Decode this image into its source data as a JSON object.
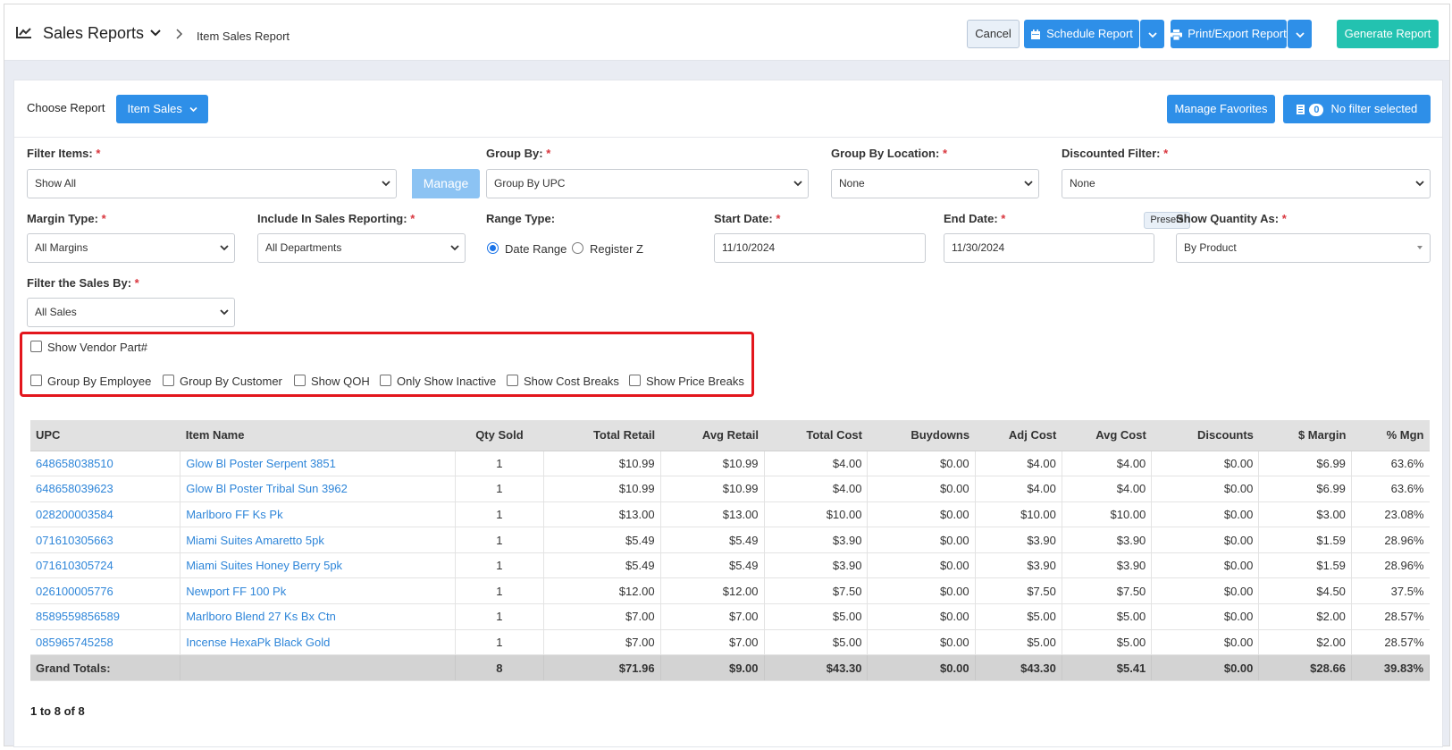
{
  "header": {
    "title": "Sales Reports",
    "breadcrumb": "Item Sales Report",
    "cancel": "Cancel",
    "schedule": "Schedule Report",
    "print": "Print/Export Report",
    "generate": "Generate Report"
  },
  "report_bar": {
    "choose_label": "Choose Report",
    "report_button": "Item Sales",
    "manage_favorites": "Manage Favorites",
    "filter_count": "0",
    "filter_text": "No filter selected"
  },
  "filters": {
    "filter_items": {
      "label": "Filter Items:",
      "value": "Show All",
      "manage": "Manage"
    },
    "group_by": {
      "label": "Group By:",
      "value": "Group By UPC"
    },
    "group_by_location": {
      "label": "Group By Location:",
      "value": "None"
    },
    "discounted": {
      "label": "Discounted Filter:",
      "value": "None"
    },
    "margin_type": {
      "label": "Margin Type:",
      "value": "All Margins"
    },
    "include_in_sales": {
      "label": "Include In Sales Reporting:",
      "value": "All Departments"
    },
    "range_type": {
      "label": "Range Type:",
      "option1": "Date Range",
      "option2": "Register Z"
    },
    "start_date": {
      "label": "Start Date:",
      "value": "11/10/2024"
    },
    "end_date": {
      "label": "End Date:",
      "value": "11/30/2024",
      "presets": "Presets"
    },
    "show_quantity": {
      "label": "Show Quantity As:",
      "value": "By Product"
    },
    "filter_sales_by": {
      "label": "Filter the Sales By:",
      "value": "All Sales"
    },
    "required_mark": "*"
  },
  "options": {
    "vendor_part": "Show Vendor Part#",
    "group_by_employee": "Group By Employee",
    "group_by_customer": "Group By Customer",
    "show_qoh": "Show QOH",
    "only_inactive": "Only Show Inactive",
    "show_cost_breaks": "Show Cost Breaks",
    "show_price_breaks": "Show Price Breaks"
  },
  "table": {
    "columns": [
      "UPC",
      "Item Name",
      "Qty Sold",
      "Total Retail",
      "Avg Retail",
      "Total Cost",
      "Buydowns",
      "Adj Cost",
      "Avg Cost",
      "Discounts",
      "$ Margin",
      "% Mgn"
    ],
    "rows": [
      [
        "648658038510",
        "Glow Bl Poster Serpent 3851",
        "1",
        "$10.99",
        "$10.99",
        "$4.00",
        "$0.00",
        "$4.00",
        "$4.00",
        "$0.00",
        "$6.99",
        "63.6%"
      ],
      [
        "648658039623",
        "Glow Bl Poster Tribal Sun 3962",
        "1",
        "$10.99",
        "$10.99",
        "$4.00",
        "$0.00",
        "$4.00",
        "$4.00",
        "$0.00",
        "$6.99",
        "63.6%"
      ],
      [
        "028200003584",
        "Marlboro FF Ks Pk",
        "1",
        "$13.00",
        "$13.00",
        "$10.00",
        "$0.00",
        "$10.00",
        "$10.00",
        "$0.00",
        "$3.00",
        "23.08%"
      ],
      [
        "071610305663",
        "Miami Suites Amaretto 5pk",
        "1",
        "$5.49",
        "$5.49",
        "$3.90",
        "$0.00",
        "$3.90",
        "$3.90",
        "$0.00",
        "$1.59",
        "28.96%"
      ],
      [
        "071610305724",
        "Miami Suites Honey Berry 5pk",
        "1",
        "$5.49",
        "$5.49",
        "$3.90",
        "$0.00",
        "$3.90",
        "$3.90",
        "$0.00",
        "$1.59",
        "28.96%"
      ],
      [
        "026100005776",
        "Newport FF 100 Pk",
        "1",
        "$12.00",
        "$12.00",
        "$7.50",
        "$0.00",
        "$7.50",
        "$7.50",
        "$0.00",
        "$4.50",
        "37.5%"
      ],
      [
        "8589559856589",
        "Marlboro Blend 27 Ks Bx Ctn",
        "1",
        "$7.00",
        "$7.00",
        "$5.00",
        "$0.00",
        "$5.00",
        "$5.00",
        "$0.00",
        "$2.00",
        "28.57%"
      ],
      [
        "085965745258",
        "Incense HexaPk Black Gold",
        "1",
        "$7.00",
        "$7.00",
        "$5.00",
        "$0.00",
        "$5.00",
        "$5.00",
        "$0.00",
        "$2.00",
        "28.57%"
      ]
    ],
    "totals": [
      "Grand Totals:",
      "",
      "8",
      "$71.96",
      "$9.00",
      "$43.30",
      "$0.00",
      "$43.30",
      "$5.41",
      "$0.00",
      "$28.66",
      "39.83%"
    ]
  },
  "pager": "1 to 8 of 8",
  "colors": {
    "primary": "#2e8fe8",
    "generate": "#23c2b0",
    "link": "#2f86d9",
    "highlight": "#e3161d"
  }
}
